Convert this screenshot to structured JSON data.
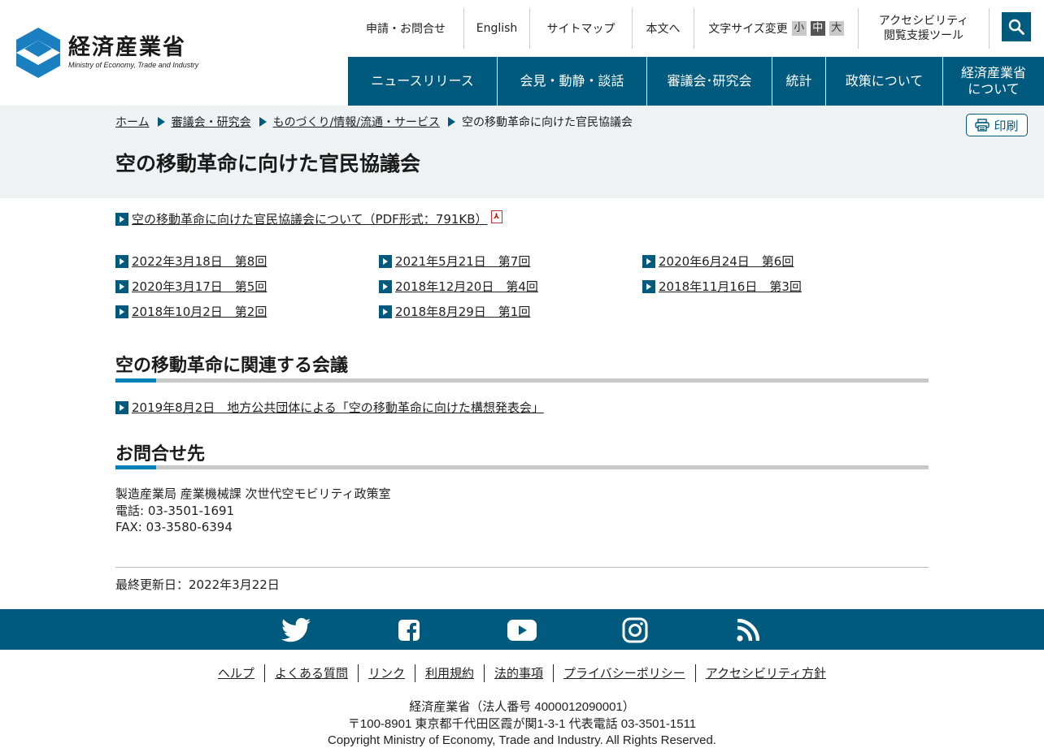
{
  "header": {
    "logo_jp": "経済産業省",
    "logo_en": "Ministry of Economy, Trade and Industry",
    "util": {
      "apply": "申請・お問合せ",
      "english": "English",
      "sitemap": "サイトマップ",
      "skip": "本文へ",
      "font_size_label": "文字サイズ変更",
      "font_small": "小",
      "font_medium": "中",
      "font_large": "大",
      "accessibility_line1": "アクセシビリティ",
      "accessibility_line2": "閲覧支援ツール"
    },
    "nav": [
      {
        "label": "ニュースリリース"
      },
      {
        "label": "会見・動静・談話"
      },
      {
        "label": "審議会･研究会"
      },
      {
        "label": "統計"
      },
      {
        "label": "政策について"
      },
      {
        "label_line1": "経済産業省",
        "label_line2": "について"
      }
    ]
  },
  "breadcrumb": [
    "ホーム",
    "審議会・研究会",
    "ものづくり/情報/流通・サービス",
    "空の移動革命に向けた官民協議会"
  ],
  "print_label": "印刷",
  "page_title": "空の移動革命に向けた官民協議会",
  "about_link": "空の移動革命に向けた官民協議会について（PDF形式：791KB）",
  "meetings": [
    "2022年3月18日　第8回",
    "2021年5月21日　第7回",
    "2020年6月24日　第6回",
    "2020年3月17日　第5回",
    "2018年12月20日　第4回",
    "2018年11月16日　第3回",
    "2018年10月2日　第2回",
    "2018年8月29日　第1回"
  ],
  "related": {
    "heading": "空の移動革命に関連する会議",
    "link": "2019年8月2日　地方公共団体による「空の移動革命に向けた構想発表会」"
  },
  "contact": {
    "heading": "お問合せ先",
    "dept": "製造産業局 産業機械課 次世代空モビリティ政策室",
    "tel": "電話: 03-3501-1691",
    "fax": "FAX: 03-3580-6394"
  },
  "last_updated": "最終更新日：2022年3月22日",
  "social": [
    "twitter-icon",
    "facebook-icon",
    "youtube-icon",
    "instagram-icon",
    "rss-icon"
  ],
  "footer": {
    "links": [
      "ヘルプ",
      "よくある質問",
      "リンク",
      "利用規約",
      "法的事項",
      "プライバシーポリシー",
      "アクセシビリティ方針"
    ],
    "org": "経済産業省（法人番号 4000012090001）",
    "address": "〒100-8901 東京都千代田区霞が関1-3-1 代表電話 03-3501-1511",
    "copyright": "Copyright Ministry of Economy, Trade and Industry. All Rights Reserved."
  },
  "colors": {
    "brand": "#005a7e",
    "accent": "#0081b8",
    "band": "#eef2f2"
  }
}
